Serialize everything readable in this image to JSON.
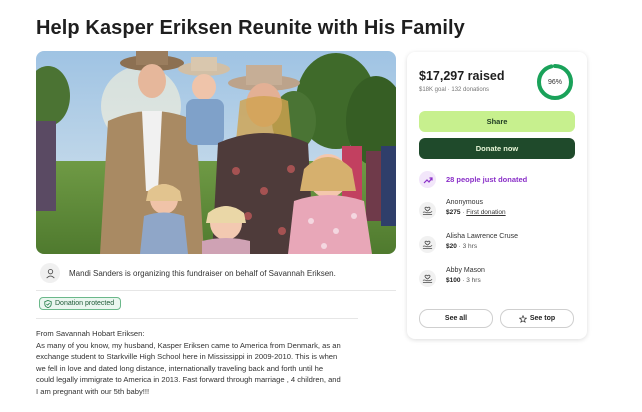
{
  "page": {
    "title": "Help Kasper Eriksen Reunite with His Family"
  },
  "organizer": {
    "text": "Mandi Sanders is organizing this fundraiser on behalf of Savannah Eriksen.",
    "icon": "person-icon"
  },
  "badge": {
    "label": "Donation protected",
    "icon": "shield-check-icon"
  },
  "story": {
    "lines": [
      "From Savannah Hobart Eriksen:",
      "As many of you know, my husband, Kasper Eriksen came to America from Denmark, as an",
      "exchange student to Starkville High School here in Mississippi in 2009-2010. This is when",
      "we fell in love and dated long distance, internationally traveling back and forth until he",
      "could legally immigrate to America in 2013. Fast forward through marriage , 4 children, and",
      "I am pregnant with our 5th baby!!!"
    ]
  },
  "donation_card": {
    "raised": "$17,297 raised",
    "goal": "$18K goal · 132 donations",
    "progress_percent": 96,
    "progress_label": "96%",
    "share_label": "Share",
    "donate_label": "Donate now",
    "trend_text": "28 people just donated",
    "donors": [
      {
        "name": "Anonymous",
        "amount": "$275",
        "meta": "First donation"
      },
      {
        "name": "Alisha Lawrence Cruse",
        "amount": "$20",
        "meta": "3 hrs"
      },
      {
        "name": "Abby Mason",
        "amount": "$100",
        "meta": "3 hrs"
      }
    ],
    "see_all_label": "See all",
    "see_top_label": "See top"
  },
  "colors": {
    "progress": "#1aa25a",
    "share_bg": "#c7f08e",
    "donate_bg": "#1f4a2b",
    "trend": "#8a2fc8"
  }
}
